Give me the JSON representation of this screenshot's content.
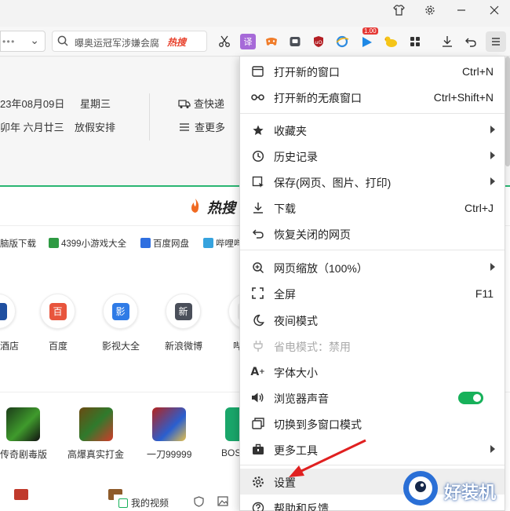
{
  "toolbar": {
    "search_text": "曝奥运冠军涉嫌会腐",
    "hot_label": "热搜",
    "badge": "1.00"
  },
  "calendar": {
    "date": "23年08月09日",
    "weekday": "星期三",
    "lunar": "卯年 六月廿三",
    "holiday": "放假安排",
    "express": "查快递",
    "more": "查更多"
  },
  "hotsearch": {
    "logo": "热搜"
  },
  "links": [
    "脑版下载",
    "4399小游戏大全",
    "百度网盘",
    "哔哩哔哩"
  ],
  "sites": [
    {
      "label": "酒店",
      "glyph": ""
    },
    {
      "label": "百度",
      "glyph": "百"
    },
    {
      "label": "影视大全",
      "glyph": "影"
    },
    {
      "label": "新浪微博",
      "glyph": "新"
    },
    {
      "label": "哔",
      "glyph": ""
    }
  ],
  "games": [
    "传奇剧毒版",
    "高爆真实打金",
    "一刀99999",
    "BOS"
  ],
  "status": {
    "my_video": "我的视频"
  },
  "menu": {
    "new_window": "打开新的窗口",
    "new_window_sc": "Ctrl+N",
    "incognito": "打开新的无痕窗口",
    "incognito_sc": "Ctrl+Shift+N",
    "favorites": "收藏夹",
    "history": "历史记录",
    "save": "保存(网页、图片、打印)",
    "download": "下载",
    "download_sc": "Ctrl+J",
    "restore": "恢复关闭的网页",
    "zoom": "网页缩放（100%）",
    "fullscreen": "全屏",
    "fullscreen_sc": "F11",
    "night": "夜间模式",
    "power": "省电模式：禁用",
    "font": "字体大小",
    "sound": "浏览器声音",
    "multi": "切换到多窗口模式",
    "tools": "更多工具",
    "settings": "设置",
    "help": "帮助和反馈"
  },
  "watermark": "好装机",
  "colors": {
    "accent_green": "#17b15a",
    "arrow_red": "#e02020",
    "hot_red": "#e8412c"
  }
}
